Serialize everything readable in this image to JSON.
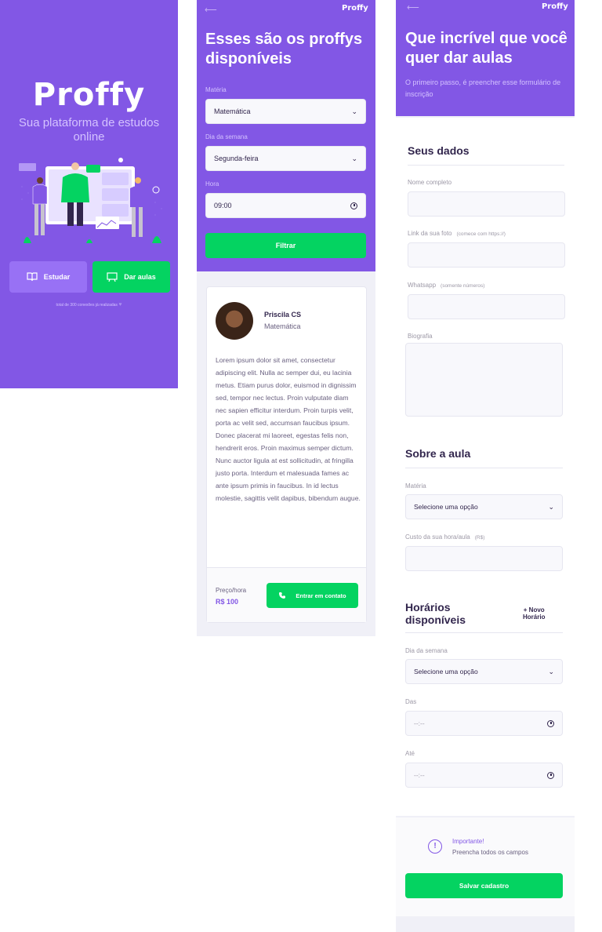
{
  "colors": {
    "primary": "#8257e5",
    "secondary": "#04d361",
    "background": "#f0f0f7"
  },
  "landing": {
    "logo": "Proffy",
    "tagline": "Sua plataforma de estudos online",
    "study_button": "Estudar",
    "teach_button": "Dar aulas",
    "connections": "total de 300 conexões já realizadas"
  },
  "list": {
    "back_icon": "arrow-left-icon",
    "logo": "Proffy",
    "title": "Esses são os proffys disponíveis",
    "filters": {
      "subject_label": "Matéria",
      "subject_value": "Matemática",
      "weekday_label": "Dia da semana",
      "weekday_value": "Segunda-feira",
      "time_label": "Hora",
      "time_value": "09:00",
      "filter_button": "Filtrar"
    },
    "teacher": {
      "name": "Priscila CS",
      "subject": "Matemática",
      "bio": "Lorem ipsum dolor sit amet, consectetur adipiscing elit. Nulla ac semper dui, eu lacinia metus. Etiam purus dolor, euismod in dignissim sed, tempor nec lectus. Proin vulputate diam nec sapien efficitur interdum. Proin turpis velit, porta ac velit sed, accumsan faucibus ipsum. Donec placerat mi laoreet, egestas felis non, hendrerit eros. Proin maximus semper dictum. Nunc auctor ligula at est sollicitudin, at fringilla justo porta. Interdum et malesuada fames ac ante ipsum primis in faucibus. In id lectus molestie, sagittis velit dapibus, bibendum augue.",
      "price_label": "Preço/hora",
      "price_value": "R$ 100",
      "contact_button": "Entrar em contato"
    }
  },
  "form": {
    "back_icon": "arrow-left-icon",
    "logo": "Proffy",
    "title": "Que incrível que você quer dar aulas",
    "subtitle": "O primeiro passo, é preencher esse formulário de inscrição",
    "personal": {
      "title": "Seus dados",
      "name_label": "Nome completo",
      "avatar_label": "Link da sua foto",
      "avatar_hint": "(comece com https://)",
      "whatsapp_label": "Whatsapp",
      "whatsapp_hint": "(somente números)",
      "bio_label": "Biografia"
    },
    "class": {
      "title": "Sobre a aula",
      "subject_label": "Matéria",
      "subject_placeholder": "Selecione uma opção",
      "cost_label": "Custo da sua hora/aula",
      "cost_hint": "(R$)"
    },
    "schedule": {
      "title": "Horários disponíveis",
      "add_button_line1": "+ Novo",
      "add_button_line2": "Horário",
      "weekday_label": "Dia da semana",
      "weekday_placeholder": "Selecione uma opção",
      "from_label": "Das",
      "from_placeholder": "--:--",
      "to_label": "Até",
      "to_placeholder": "--:--"
    },
    "footer": {
      "warning_title": "Importante!",
      "warning_text": "Preencha todos os campos",
      "save_button": "Salvar cadastro"
    }
  }
}
